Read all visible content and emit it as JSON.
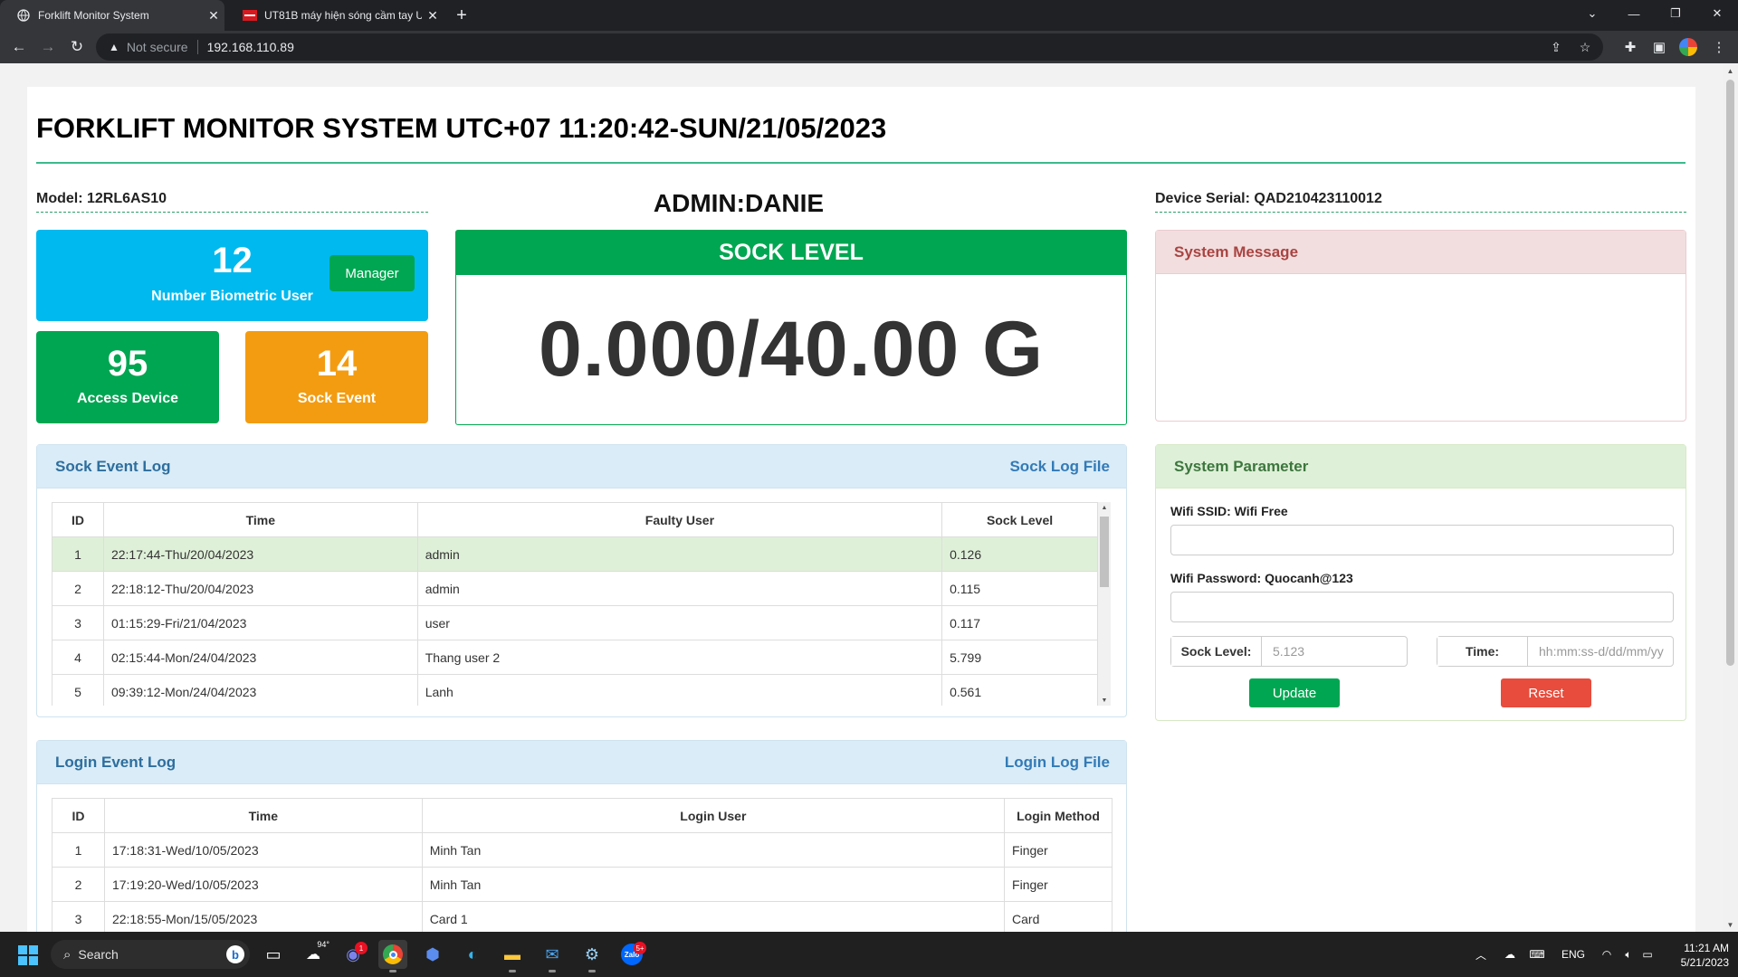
{
  "browser": {
    "tabs": [
      {
        "title": "Forklift Monitor System",
        "close": "✕"
      },
      {
        "title": "UT81B máy hiện sóng cầm tay U",
        "close": "✕"
      }
    ],
    "new_tab": "+",
    "address": {
      "warning": "Not secure",
      "url": "192.168.110.89"
    }
  },
  "page": {
    "title": "FORKLIFT MONITOR SYSTEM UTC+07 11:20:42-SUN/21/05/2023",
    "model": "Model: 12RL6AS10",
    "admin": "ADMIN:DANIE",
    "serial": "Device Serial: QAD210423110012"
  },
  "stats": {
    "biometric": {
      "value": "12",
      "label": "Number Biometric User",
      "button": "Manager",
      "color": "#00b9ef"
    },
    "access": {
      "value": "95",
      "label": "Access Device",
      "color": "#00a651"
    },
    "sock_event": {
      "value": "14",
      "label": "Sock Event",
      "color": "#f39c12"
    }
  },
  "sock_level": {
    "header": "SOCK LEVEL",
    "value": "0.000/40.00 G"
  },
  "system_message": {
    "title": "System Message"
  },
  "sock_log": {
    "title": "Sock Event Log",
    "link": "Sock Log File",
    "headers": [
      "ID",
      "Time",
      "Faulty User",
      "Sock Level"
    ],
    "rows": [
      [
        "1",
        "22:17:44-Thu/20/04/2023",
        "admin",
        "0.126"
      ],
      [
        "2",
        "22:18:12-Thu/20/04/2023",
        "admin",
        "0.115"
      ],
      [
        "3",
        "01:15:29-Fri/21/04/2023",
        "user",
        "0.117"
      ],
      [
        "4",
        "02:15:44-Mon/24/04/2023",
        "Thang user 2",
        "5.799"
      ],
      [
        "5",
        "09:39:12-Mon/24/04/2023",
        "Lanh",
        "0.561"
      ]
    ]
  },
  "login_log": {
    "title": "Login Event Log",
    "link": "Login Log File",
    "headers": [
      "ID",
      "Time",
      "Login User",
      "Login Method"
    ],
    "rows": [
      [
        "1",
        "17:18:31-Wed/10/05/2023",
        "Minh Tan",
        "Finger"
      ],
      [
        "2",
        "17:19:20-Wed/10/05/2023",
        "Minh Tan",
        "Finger"
      ],
      [
        "3",
        "22:18:55-Mon/15/05/2023",
        "Card 1",
        "Card"
      ]
    ]
  },
  "params": {
    "title": "System Parameter",
    "wifi_ssid_label": "Wifi SSID: Wifi Free",
    "wifi_pass_label": "Wifi Password: Quocanh@123",
    "sock_level_label": "Sock Level:",
    "sock_level_placeholder": "5.123",
    "time_label": "Time:",
    "time_placeholder": "hh:mm:ss-d/dd/mm/yy",
    "update": "Update",
    "reset": "Reset"
  },
  "taskbar": {
    "search": "Search",
    "weather": "94°",
    "chat_badge": "1",
    "zalo_badge": "5+",
    "lang": "ENG",
    "time": "11:21 AM",
    "date": "5/21/2023"
  }
}
